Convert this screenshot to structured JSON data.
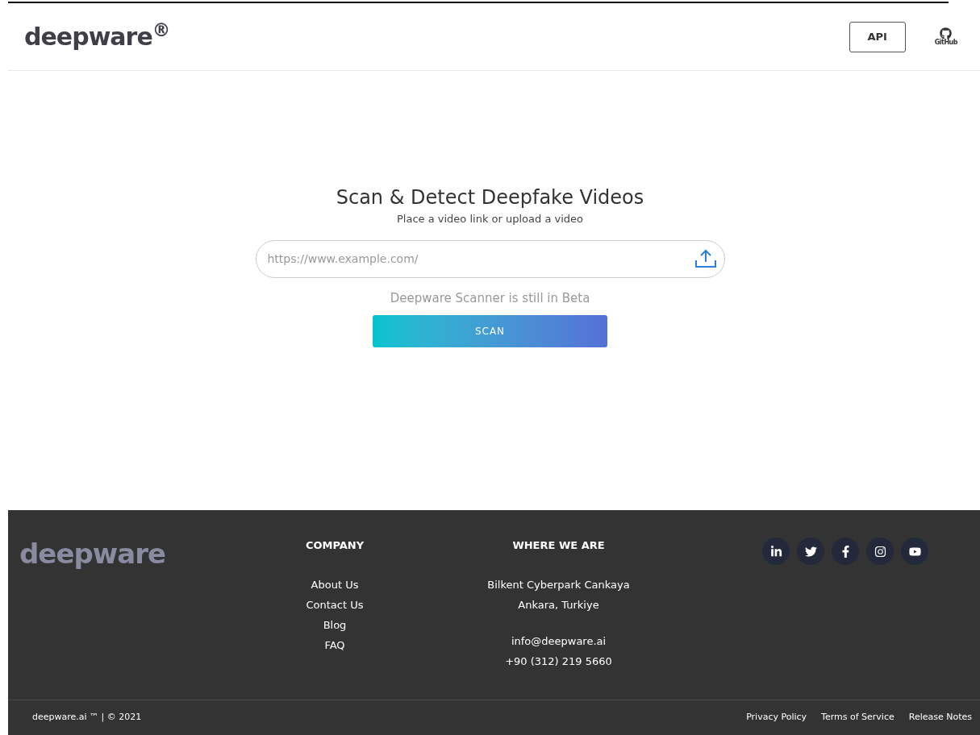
{
  "header": {
    "logo": "deepware$^{®}$",
    "api_button": "API",
    "github_label": "GitHub"
  },
  "hero": {
    "title": "Scan & Detect Deepfake Videos",
    "subtitle": "Place a video link or upload a video",
    "url_field": {
      "placeholder": "https://www.example.com/"
    },
    "beta_note": "Deepware Scanner is still in Beta",
    "scan_button": "SCAN"
  },
  "footer": {
    "logo": "deepware",
    "company": {
      "heading": "COMPANY",
      "links": [
        "About Us",
        "Contact Us",
        "Blog",
        "FAQ"
      ]
    },
    "where_we_are": {
      "heading": "WHERE WE ARE",
      "address": [
        "Bilkent Cyberpark Cankaya",
        "Ankara, Turkiye"
      ],
      "contact": [
        "info@deepware.ai",
        "+90 (312) 219 5660"
      ]
    },
    "social": [
      {
        "kind": "linkedin"
      },
      {
        "kind": "twitter"
      },
      {
        "kind": "facebook"
      },
      {
        "kind": "instagram"
      },
      {
        "kind": "youtube"
      }
    ],
    "copyright": "deepware.ai ™ | © 2021",
    "bottom_links": [
      "Privacy Policy",
      "Terms of Service",
      "Release Notes"
    ]
  }
}
